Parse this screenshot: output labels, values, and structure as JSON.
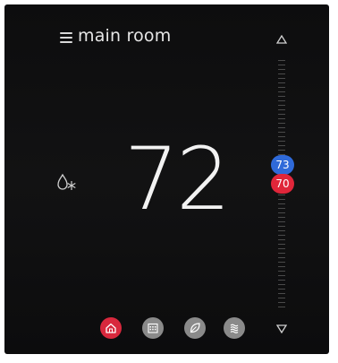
{
  "header": {
    "room_name": "main room"
  },
  "thermostat": {
    "current_temp": "72",
    "cool_setpoint": "73",
    "heat_setpoint": "70"
  },
  "nav": [
    {
      "name": "home",
      "active": true
    },
    {
      "name": "schedule",
      "active": false
    },
    {
      "name": "eco",
      "active": false
    },
    {
      "name": "humidity",
      "active": false
    }
  ],
  "colors": {
    "cool": "#2f6ad9",
    "heat": "#e0263a",
    "active_nav": "#d8283d",
    "inactive_nav": "#8a8a8a"
  },
  "icons": {
    "menu": "hamburger-icon",
    "mode": "auto-heat-cool-icon",
    "up": "triangle-up-icon",
    "down": "triangle-down-icon",
    "home": "home-icon",
    "schedule": "calendar-icon",
    "eco": "leaf-icon",
    "humidity": "humidity-icon"
  }
}
